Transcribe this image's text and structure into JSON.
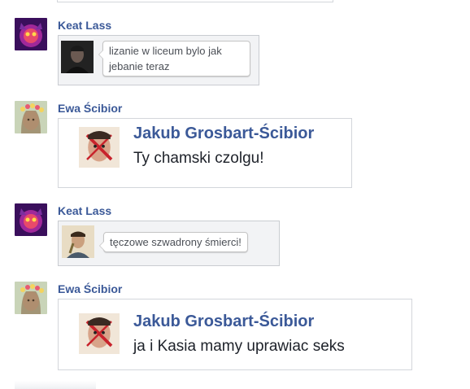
{
  "messages": [
    {
      "author": "Keat Lass",
      "avatar_icon": "purple-glow-avatar",
      "type": "bubble",
      "thumb_icon": "dark-portrait-thumbnail",
      "text": "lizanie w liceum bylo jak jebanie teraz"
    },
    {
      "author": "Ewa Ścibior",
      "avatar_icon": "flower-crown-avatar",
      "type": "card",
      "card_author": "Jakub Grosbart-Ścibior",
      "thumb_icon": "red-face-thumbnail",
      "text": "Ty chamski czolgu!"
    },
    {
      "author": "Keat Lass",
      "avatar_icon": "purple-glow-avatar",
      "type": "bubble",
      "thumb_icon": "man-portrait-thumbnail",
      "text": "tęczowe szwadrony śmierci!"
    },
    {
      "author": "Ewa Ścibior",
      "avatar_icon": "flower-crown-avatar",
      "type": "card",
      "card_author": "Jakub Grosbart-Ścibior",
      "thumb_icon": "red-face-thumbnail",
      "text": "ja i Kasia mamy uprawiac seks"
    }
  ],
  "colors": {
    "name_link": "#3b5998",
    "text": "#1d2129",
    "border": "#d3d6db"
  }
}
